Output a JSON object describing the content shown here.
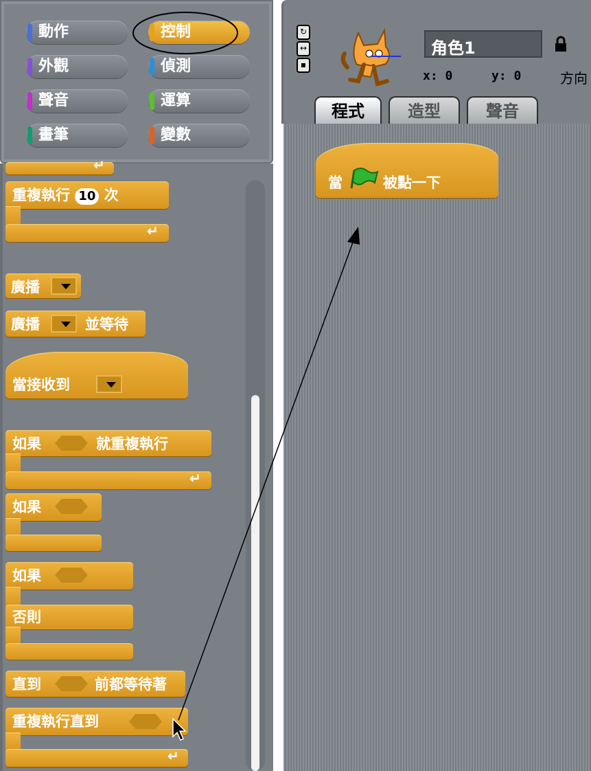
{
  "categories": {
    "items": [
      {
        "label": "動作",
        "color": "#4b6fd6",
        "selected": false
      },
      {
        "label": "控制",
        "color": "#e6a21d",
        "selected": true
      },
      {
        "label": "外觀",
        "color": "#8a4fd4",
        "selected": false
      },
      {
        "label": "偵測",
        "color": "#2d8fd6",
        "selected": false
      },
      {
        "label": "聲音",
        "color": "#c62dc9",
        "selected": false
      },
      {
        "label": "運算",
        "color": "#5cbf2d",
        "selected": false
      },
      {
        "label": "畫筆",
        "color": "#0f9f6e",
        "selected": false
      },
      {
        "label": "變數",
        "color": "#e2601e",
        "selected": false
      }
    ]
  },
  "palette": {
    "repeat_label": "重複執行",
    "repeat_count": "10",
    "repeat_suffix": "次",
    "broadcast_label": "廣播",
    "broadcast_wait_label": "廣播",
    "broadcast_wait_suffix": "並等待",
    "when_receive_label": "當接收到",
    "forever_if_prefix": "如果",
    "forever_if_suffix": "就重複執行",
    "if_label": "如果",
    "ifelse_label": "如果",
    "else_label": "否則",
    "wait_until_prefix": "直到",
    "wait_until_suffix": "前都等待著",
    "repeat_until_label": "重複執行直到"
  },
  "sprite": {
    "name": "角色1",
    "x_label": "x:",
    "x_value": "0",
    "y_label": "y:",
    "y_value": "0",
    "direction_label": "方向"
  },
  "tabs": [
    {
      "label": "程式",
      "active": true
    },
    {
      "label": "造型",
      "active": false
    },
    {
      "label": "聲音",
      "active": false
    }
  ],
  "script": {
    "hat_prefix": "當",
    "hat_suffix": "被點一下"
  },
  "colors": {
    "control_block": "#e6a82c",
    "panel": "#7b8187",
    "flag": "#2fb52f"
  }
}
